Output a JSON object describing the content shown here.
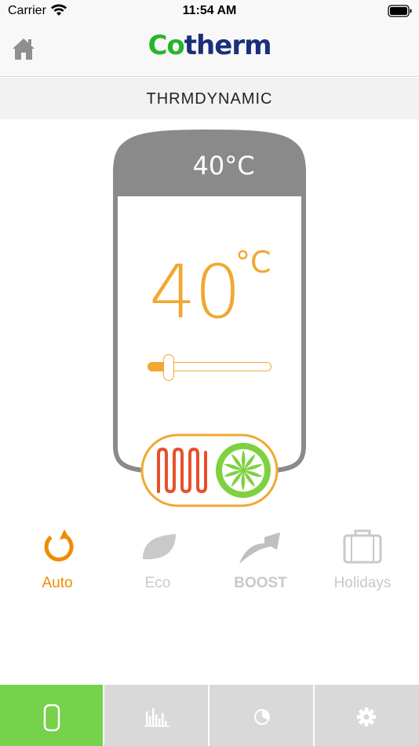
{
  "status_bar": {
    "carrier": "Carrier",
    "time": "11:54 AM"
  },
  "header": {
    "logo_co": "Co",
    "logo_therm": "therm",
    "subtitle": "THRMDYNAMIC"
  },
  "tank": {
    "top_temperature": "40°C",
    "setpoint_value": "40",
    "setpoint_unit": "°C",
    "slider_fraction": 0.14
  },
  "modes": [
    {
      "label": "Auto",
      "icon": "auto-cycle-icon",
      "active": true
    },
    {
      "label": "Eco",
      "icon": "leaf-icon",
      "active": false
    },
    {
      "label": "BOOST",
      "icon": "boost-arrow-icon",
      "active": false
    },
    {
      "label": "Holidays",
      "icon": "suitcase-icon",
      "active": false
    }
  ],
  "tabs": [
    {
      "icon": "tank-icon",
      "active": true
    },
    {
      "icon": "bar-chart-icon",
      "active": false
    },
    {
      "icon": "pie-chart-icon",
      "active": false
    },
    {
      "icon": "gear-icon",
      "active": false
    }
  ],
  "colors": {
    "accent_orange": "#f0a830",
    "active_mode": "#ef8c00",
    "tab_active": "#76d14b",
    "tank_gray": "#8a8a8a",
    "logo_green": "#27b52a",
    "logo_navy": "#1b2f7a",
    "heater_red": "#e8502a",
    "fan_green": "#7ed13f"
  }
}
